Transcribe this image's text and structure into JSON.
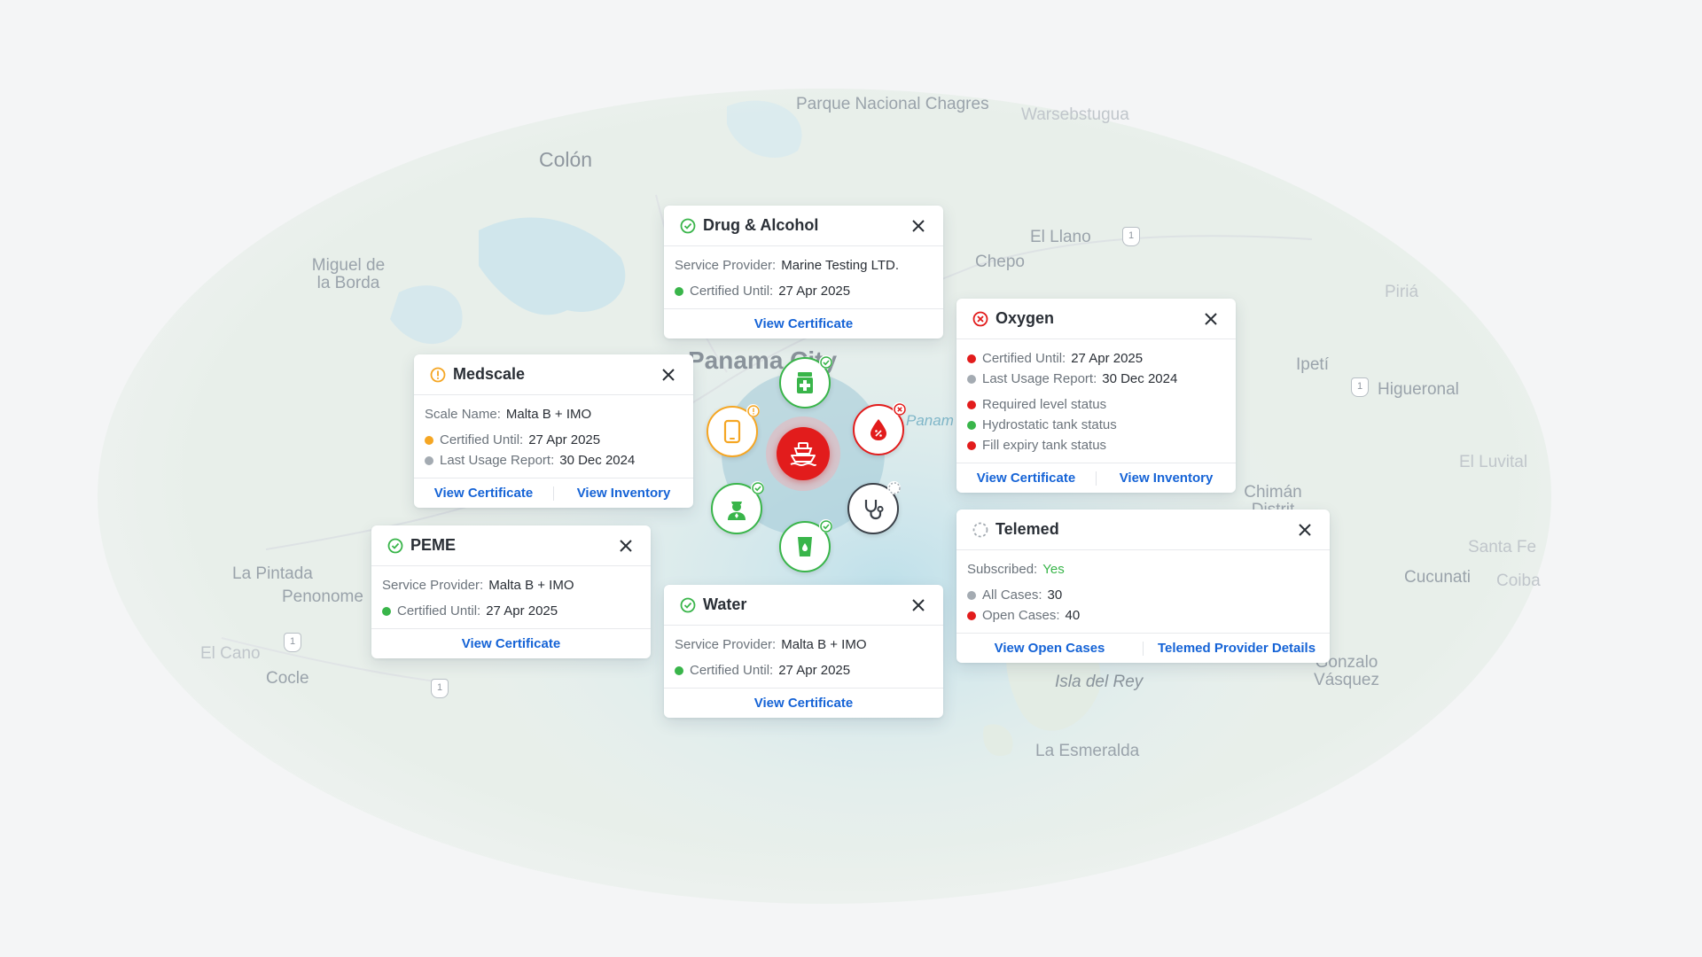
{
  "colors": {
    "green": "#39b54a",
    "red": "#e21c1c",
    "orange": "#f5a623",
    "gray": "#a4abb2",
    "link": "#1563d6",
    "water": "#cfe8f0"
  },
  "map": {
    "labels": [
      "Parque Nacional Chagres",
      "Colón",
      "Warsebstugua",
      "El Llano",
      "Chepo",
      "Miguel de la Borda",
      "Piriá",
      "Panama City",
      "Panam",
      "Ipetí",
      "Higueronal",
      "El Luvital",
      "Chimán Distrit",
      "Santa Fe",
      "Cucunati",
      "Coiba",
      "La Pintada",
      "Penonome",
      "El Cano",
      "Cocle",
      "Isla del Rey",
      "Gonzalo Vásquez",
      "La Esmeralda"
    ],
    "route_shields": [
      "1",
      "1",
      "1",
      "1"
    ]
  },
  "hub": {
    "center_icon": "ship-icon",
    "nodes": [
      {
        "name": "drug-alcohol",
        "icon": "medicine-bottle-icon",
        "status": "ok"
      },
      {
        "name": "medscale",
        "icon": "tablet-device-icon",
        "status": "warning"
      },
      {
        "name": "oxygen",
        "icon": "blood-drop-icon",
        "status": "error"
      },
      {
        "name": "peme",
        "icon": "seafarer-icon",
        "status": "ok"
      },
      {
        "name": "telemed",
        "icon": "stethoscope-icon",
        "status": "pending"
      },
      {
        "name": "water",
        "icon": "water-glass-icon",
        "status": "ok"
      }
    ]
  },
  "cards": {
    "drug": {
      "title": "Drug & Alcohol",
      "status": "check-circle-icon",
      "provider_label": "Service Provider:",
      "provider_value": "Marine Testing  LTD.",
      "cert_label": "Certified Until:",
      "cert_value": "27 Apr 2025",
      "link1": "View Certificate"
    },
    "oxygen": {
      "title": "Oxygen",
      "status": "x-circle-icon",
      "cert_label": "Certified Until:",
      "cert_value": "27 Apr 2025",
      "usage_label": "Last Usage Report:",
      "usage_value": "30  Dec 2024",
      "level": "Required level status",
      "hydro": "Hydrostatic tank status",
      "fill": "Fill expiry tank status",
      "link1": "View Certificate",
      "link2": "View Inventory"
    },
    "medscale": {
      "title": "Medscale",
      "status": "alert-circle-icon",
      "scale_label": "Scale Name:",
      "scale_value": "Malta B + IMO",
      "cert_label": "Certified Until:",
      "cert_value": "27 Apr 2025",
      "usage_label": "Last Usage Report:",
      "usage_value": "30  Dec 2024",
      "link1": "View Certificate",
      "link2": "View Inventory"
    },
    "peme": {
      "title": "PEME",
      "status": "check-circle-icon",
      "provider_label": "Service Provider:",
      "provider_value": "Malta B + IMO",
      "cert_label": "Certified Until:",
      "cert_value": "27 Apr 2025",
      "link1": "View Certificate"
    },
    "water": {
      "title": "Water",
      "status": "check-circle-icon",
      "provider_label": "Service Provider:",
      "provider_value": "Malta B + IMO",
      "cert_label": "Certified Until:",
      "cert_value": "27 Apr 2025",
      "link1": "View Certificate"
    },
    "telemed": {
      "title": "Telemed",
      "status": "dashed-circle-icon",
      "sub_label": "Subscribed:",
      "sub_value": "Yes",
      "all_label": "All Cases:",
      "all_value": "30",
      "open_label": "Open Cases:",
      "open_value": "40",
      "link1": "View Open Cases",
      "link2": "Telemed Provider Details"
    }
  }
}
